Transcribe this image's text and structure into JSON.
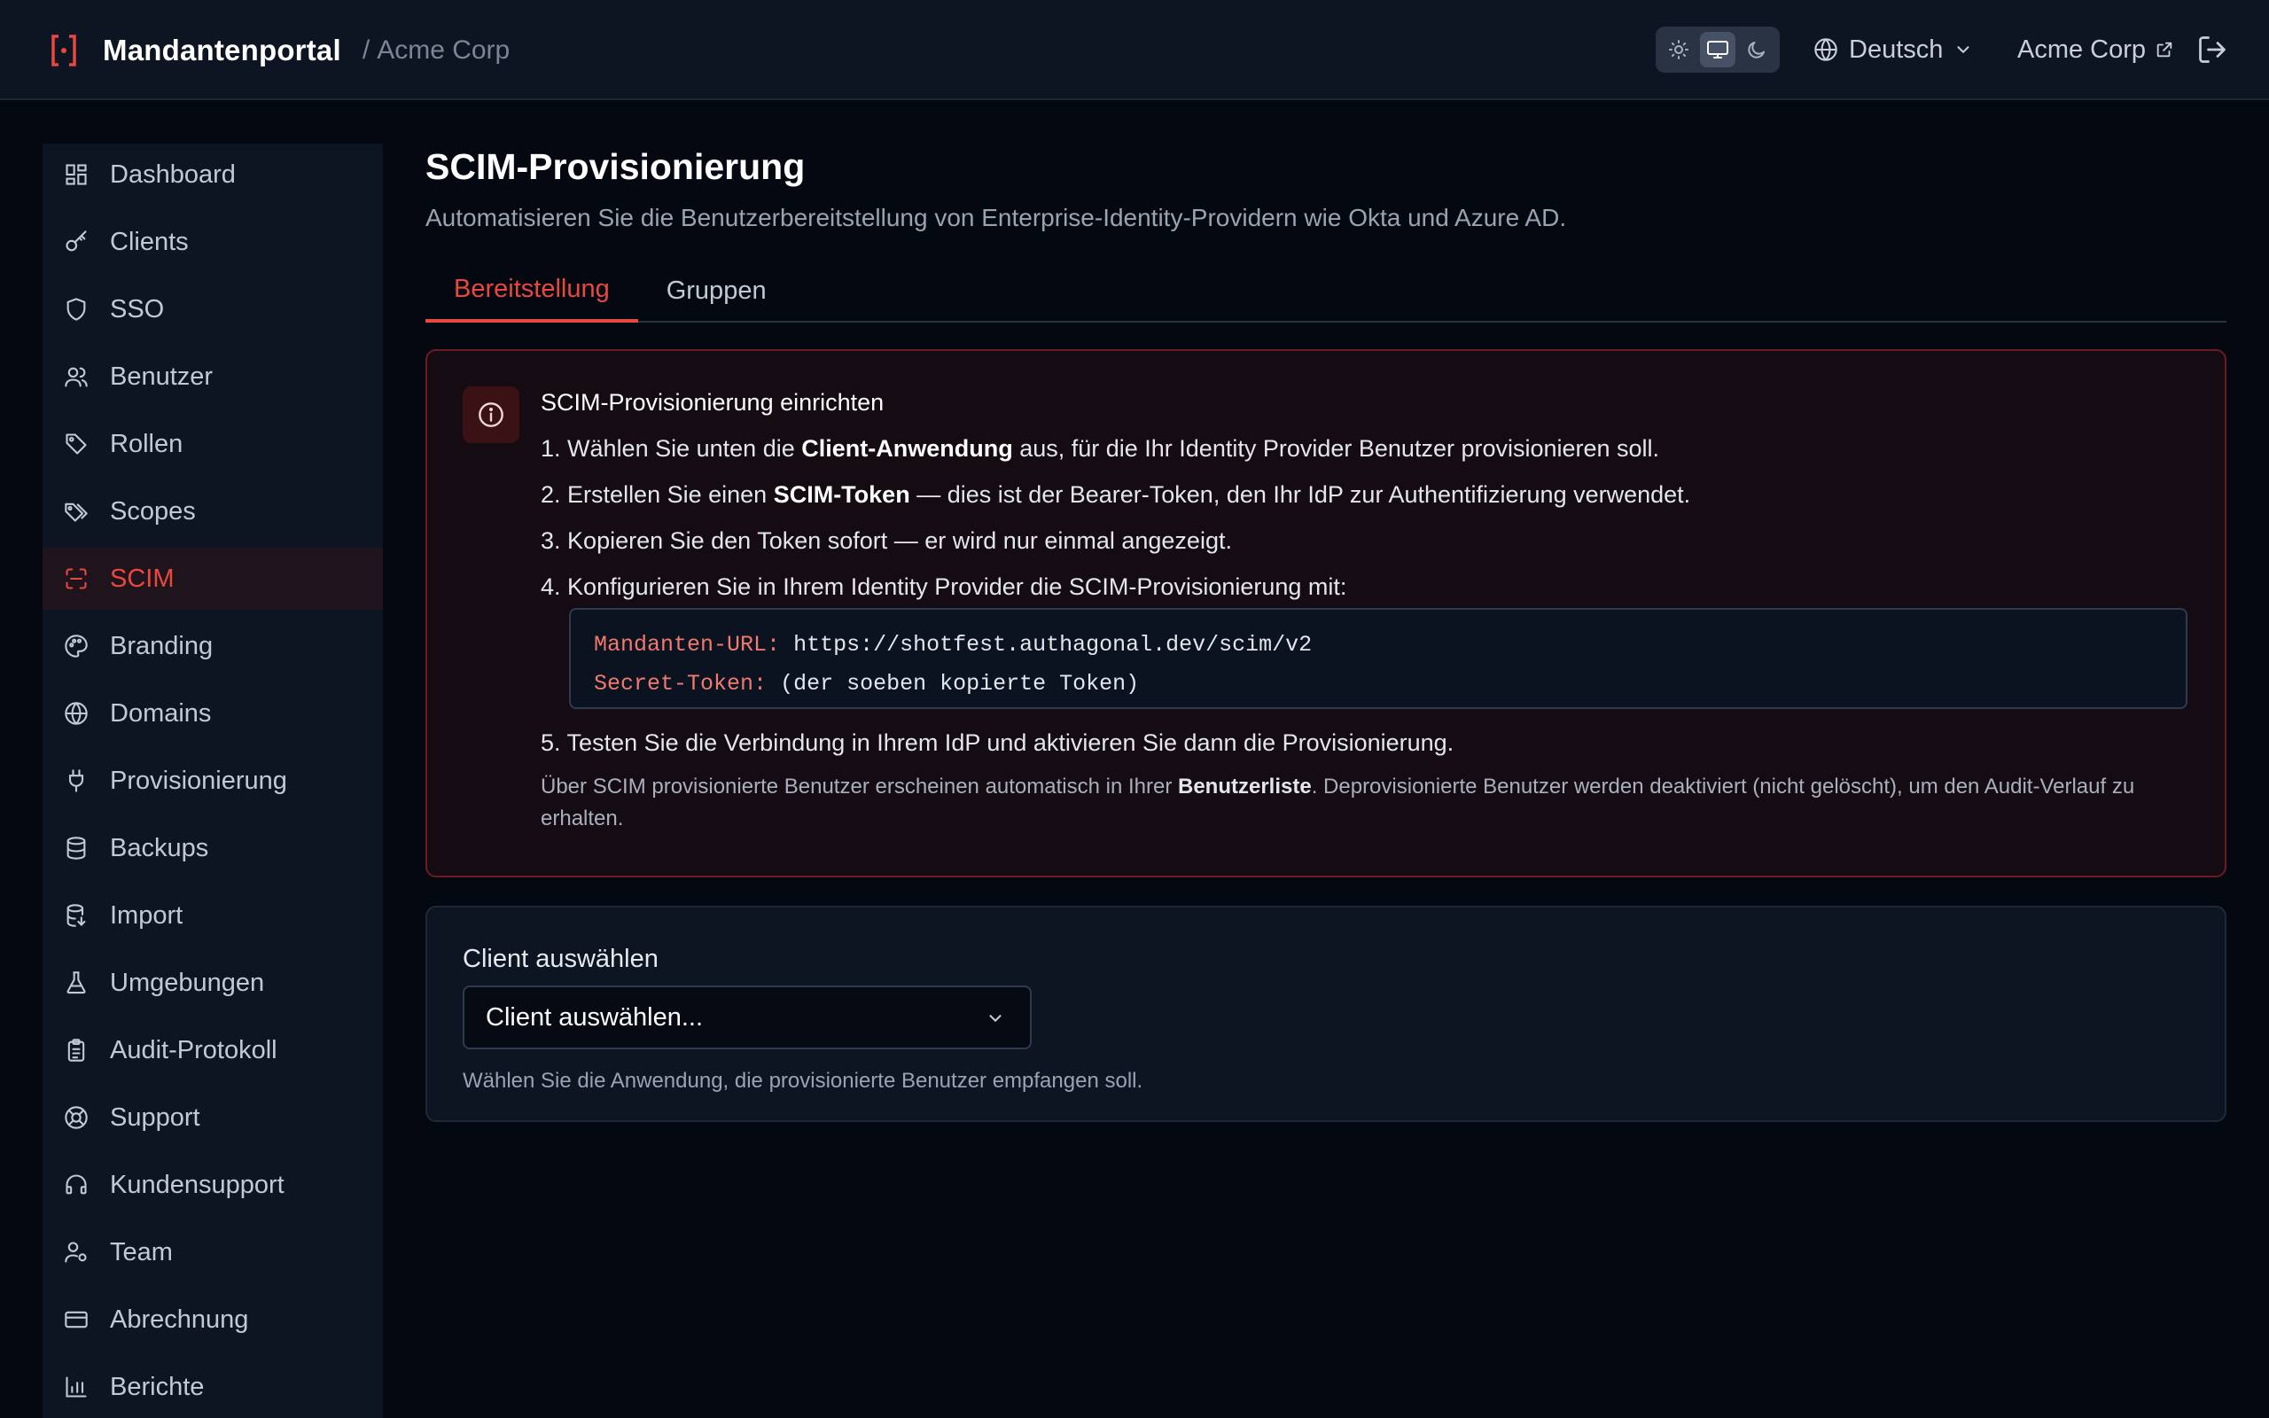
{
  "header": {
    "title": "Mandantenportal",
    "separator": "/",
    "tenant": "Acme Corp",
    "language": "Deutsch",
    "tenant_link": "Acme Corp"
  },
  "sidebar": {
    "items": [
      {
        "label": "Dashboard",
        "icon": "dashboard-icon"
      },
      {
        "label": "Clients",
        "icon": "key-icon"
      },
      {
        "label": "SSO",
        "icon": "shield-icon"
      },
      {
        "label": "Benutzer",
        "icon": "users-icon"
      },
      {
        "label": "Rollen",
        "icon": "tag-icon"
      },
      {
        "label": "Scopes",
        "icon": "tags-icon"
      },
      {
        "label": "SCIM",
        "icon": "scan-icon"
      },
      {
        "label": "Branding",
        "icon": "palette-icon"
      },
      {
        "label": "Domains",
        "icon": "globe-icon"
      },
      {
        "label": "Provisionierung",
        "icon": "plug-icon"
      },
      {
        "label": "Backups",
        "icon": "database-icon"
      },
      {
        "label": "Import",
        "icon": "database-import-icon"
      },
      {
        "label": "Umgebungen",
        "icon": "flask-icon"
      },
      {
        "label": "Audit-Protokoll",
        "icon": "clipboard-icon"
      },
      {
        "label": "Support",
        "icon": "lifebuoy-icon"
      },
      {
        "label": "Kundensupport",
        "icon": "headset-icon"
      },
      {
        "label": "Team",
        "icon": "user-cog-icon"
      },
      {
        "label": "Abrechnung",
        "icon": "credit-card-icon"
      },
      {
        "label": "Berichte",
        "icon": "bar-chart-icon"
      }
    ],
    "active": "SCIM"
  },
  "page": {
    "title": "SCIM-Provisionierung",
    "subtitle": "Automatisieren Sie die Benutzerbereitstellung von Enterprise-Identity-Providern wie Okta und Azure AD."
  },
  "tabs": [
    {
      "label": "Bereitstellung",
      "active": true
    },
    {
      "label": "Gruppen",
      "active": false
    }
  ],
  "alert": {
    "title": "SCIM-Provisionierung einrichten",
    "step1": {
      "num": "1.",
      "pre": "Wählen Sie unten die ",
      "bold": "Client-Anwendung",
      "post": " aus, für die Ihr Identity Provider Benutzer provisionieren soll."
    },
    "step2": {
      "num": "2.",
      "pre": "Erstellen Sie einen ",
      "bold": "SCIM-Token",
      "post": " — dies ist der Bearer-Token, den Ihr IdP zur Authentifizierung verwendet."
    },
    "step3": {
      "num": "3.",
      "text": "Kopieren Sie den Token sofort — er wird nur einmal angezeigt."
    },
    "step4": {
      "num": "4.",
      "text": "Konfigurieren Sie in Ihrem Identity Provider die SCIM-Provisionierung mit:"
    },
    "code": {
      "url_key": "Mandanten-URL:",
      "url_val": "https://shotfest.authagonal.dev/scim/v2",
      "token_key": "Secret-Token:",
      "token_val": "(der soeben kopierte Token)"
    },
    "step5": {
      "num": "5.",
      "text": "Testen Sie die Verbindung in Ihrem IdP und aktivieren Sie dann die Provisionierung."
    },
    "note": {
      "pre": "Über SCIM provisionierte Benutzer erscheinen automatisch in Ihrer ",
      "bold": "Benutzerliste",
      "post": ". Deprovisionierte Benutzer werden deaktiviert (nicht gelöscht), um den Audit-Verlauf zu erhalten."
    }
  },
  "client_card": {
    "label": "Client auswählen",
    "select_value": "Client auswählen...",
    "help": "Wählen Sie die Anwendung, die provisionierte Benutzer empfangen soll."
  },
  "colors": {
    "accent": "#e9483e",
    "background": "#040811",
    "panel": "#0e1522"
  }
}
